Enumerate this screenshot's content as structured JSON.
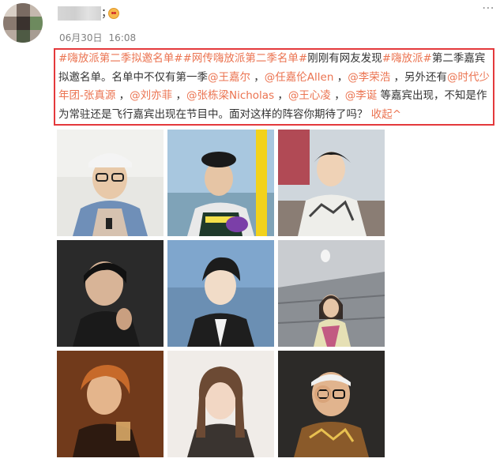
{
  "post": {
    "username_sep": "；",
    "date": "06月30日",
    "time": "16:08",
    "more_icon": "more-dots-icon",
    "emoji_icon": "emoji-icon"
  },
  "content": {
    "tag1": "#嗨放派第二季拟邀名单#",
    "tag2": "#网传嗨放派第二季名单#",
    "text1": "刚刚有网友发现",
    "tag3": "#嗨放派#",
    "text2": "第二季嘉宾拟邀名单。名单中不仅有第一季",
    "m1": "@王嘉尔",
    "c1": " ，",
    "m2": "@任嘉伦Allen",
    "c2": " ，",
    "m3": "@李荣浩",
    "text3": " ，另外还有",
    "m4": "@时代少年团-张真源",
    "c3": " ，",
    "m5": "@刘亦菲",
    "c4": " ，",
    "m6": "@张栋梁Nicholas",
    "c5": " ，",
    "m7": "@王心凌",
    "c6": " ，",
    "m8": "@李诞",
    "text4": " 等嘉宾出现，不知是作为常驻还是飞行嘉宾出现在节目中。面对这样的阵容你期待了吗？",
    "collapse": "收起",
    "collapse_icon": "chevron-up-icon"
  },
  "photos": [
    {
      "name": "photo-1"
    },
    {
      "name": "photo-2"
    },
    {
      "name": "photo-3"
    },
    {
      "name": "photo-4"
    },
    {
      "name": "photo-5"
    },
    {
      "name": "photo-6"
    },
    {
      "name": "photo-7"
    },
    {
      "name": "photo-8"
    },
    {
      "name": "photo-9"
    }
  ]
}
